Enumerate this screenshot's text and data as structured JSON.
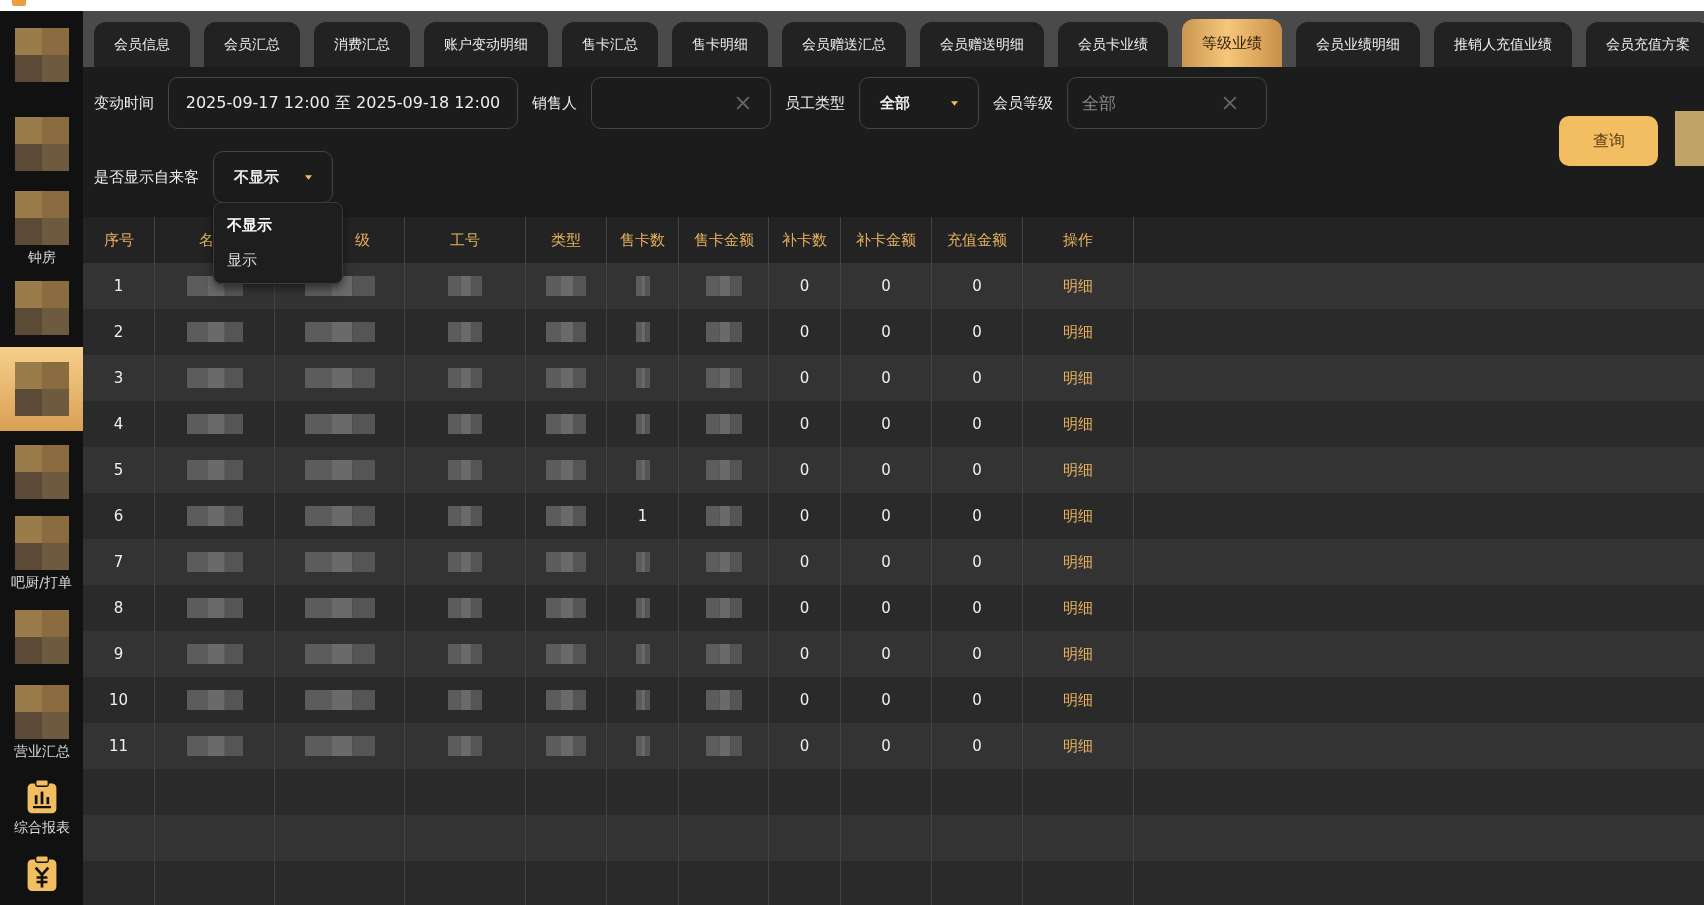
{
  "sidebar": {
    "items": [
      {
        "kind": "blurred",
        "selected": false
      },
      {
        "kind": "blurred",
        "selected": false
      },
      {
        "kind": "blurred",
        "label": "钟房",
        "selected": false
      },
      {
        "kind": "blurred",
        "selected": false
      },
      {
        "kind": "blurred",
        "selected": true
      },
      {
        "kind": "blurred",
        "selected": false
      },
      {
        "kind": "blurred",
        "label": "吧厨/打单",
        "selected": false
      },
      {
        "kind": "blurred",
        "selected": false
      },
      {
        "kind": "blurred",
        "label": "营业汇总",
        "selected": false
      },
      {
        "kind": "report",
        "label": "综合报表",
        "selected": false
      },
      {
        "kind": "yuan",
        "selected": false
      }
    ]
  },
  "tabs": [
    {
      "label": "会员信息",
      "selected": false
    },
    {
      "label": "会员汇总",
      "selected": false
    },
    {
      "label": "消费汇总",
      "selected": false
    },
    {
      "label": "账户变动明细",
      "selected": false
    },
    {
      "label": "售卡汇总",
      "selected": false
    },
    {
      "label": "售卡明细",
      "selected": false
    },
    {
      "label": "会员赠送汇总",
      "selected": false
    },
    {
      "label": "会员赠送明细",
      "selected": false
    },
    {
      "label": "会员卡业绩",
      "selected": false
    },
    {
      "label": "等级业绩",
      "selected": true
    },
    {
      "label": "会员业绩明细",
      "selected": false
    },
    {
      "label": "推销人充值业绩",
      "selected": false
    },
    {
      "label": "会员充值方案",
      "selected": false
    }
  ],
  "filters": {
    "change_time": {
      "label": "变动时间",
      "value": "2025-09-17 12:00 至 2025-09-18 12:00"
    },
    "salesperson": {
      "label": "销售人"
    },
    "staff_type": {
      "label": "员工类型",
      "value": "全部"
    },
    "member_level": {
      "label": "会员等级",
      "placeholder": "全部"
    },
    "show_walk_in": {
      "label": "是否显示自来客",
      "value": "不显示",
      "expanded": true,
      "options": [
        {
          "label": "不显示",
          "selected": true
        },
        {
          "label": "显示",
          "selected": false
        }
      ]
    },
    "query_button": "查询"
  },
  "table": {
    "columns": [
      "序号",
      "名",
      "级",
      "工号",
      "类型",
      "售卡数",
      "售卡金额",
      "补卡数",
      "补卡金额",
      "充值金额",
      "操作"
    ],
    "rows": [
      {
        "cells": [
          {
            "kind": "text",
            "text": "1"
          },
          {
            "kind": "blurred"
          },
          {
            "kind": "blurred"
          },
          {
            "kind": "blurred"
          },
          {
            "kind": "blurred"
          },
          {
            "kind": "blurred"
          },
          {
            "kind": "blurred"
          },
          {
            "kind": "text",
            "text": "0"
          },
          {
            "kind": "text",
            "text": "0"
          },
          {
            "kind": "text",
            "text": "0"
          },
          {
            "kind": "link",
            "text": "明细"
          }
        ]
      },
      {
        "cells": [
          {
            "kind": "text",
            "text": "2"
          },
          {
            "kind": "blurred"
          },
          {
            "kind": "blurred"
          },
          {
            "kind": "blurred"
          },
          {
            "kind": "blurred"
          },
          {
            "kind": "blurred"
          },
          {
            "kind": "blurred"
          },
          {
            "kind": "text",
            "text": "0"
          },
          {
            "kind": "text",
            "text": "0"
          },
          {
            "kind": "text",
            "text": "0"
          },
          {
            "kind": "link",
            "text": "明细"
          }
        ]
      },
      {
        "cells": [
          {
            "kind": "text",
            "text": "3"
          },
          {
            "kind": "blurred"
          },
          {
            "kind": "blurred"
          },
          {
            "kind": "blurred"
          },
          {
            "kind": "blurred"
          },
          {
            "kind": "blurred"
          },
          {
            "kind": "blurred"
          },
          {
            "kind": "text",
            "text": "0"
          },
          {
            "kind": "text",
            "text": "0"
          },
          {
            "kind": "text",
            "text": "0"
          },
          {
            "kind": "link",
            "text": "明细"
          }
        ]
      },
      {
        "cells": [
          {
            "kind": "text",
            "text": "4"
          },
          {
            "kind": "blurred"
          },
          {
            "kind": "blurred"
          },
          {
            "kind": "blurred"
          },
          {
            "kind": "blurred"
          },
          {
            "kind": "blurred"
          },
          {
            "kind": "blurred"
          },
          {
            "kind": "text",
            "text": "0"
          },
          {
            "kind": "text",
            "text": "0"
          },
          {
            "kind": "text",
            "text": "0"
          },
          {
            "kind": "link",
            "text": "明细"
          }
        ]
      },
      {
        "cells": [
          {
            "kind": "text",
            "text": "5"
          },
          {
            "kind": "blurred"
          },
          {
            "kind": "blurred"
          },
          {
            "kind": "blurred"
          },
          {
            "kind": "blurred"
          },
          {
            "kind": "blurred"
          },
          {
            "kind": "blurred"
          },
          {
            "kind": "text",
            "text": "0"
          },
          {
            "kind": "text",
            "text": "0"
          },
          {
            "kind": "text",
            "text": "0"
          },
          {
            "kind": "link",
            "text": "明细"
          }
        ]
      },
      {
        "cells": [
          {
            "kind": "text",
            "text": "6"
          },
          {
            "kind": "blurred"
          },
          {
            "kind": "blurred"
          },
          {
            "kind": "blurred"
          },
          {
            "kind": "blurred"
          },
          {
            "kind": "text",
            "text": "1"
          },
          {
            "kind": "blurred"
          },
          {
            "kind": "text",
            "text": "0"
          },
          {
            "kind": "text",
            "text": "0"
          },
          {
            "kind": "text",
            "text": "0"
          },
          {
            "kind": "link",
            "text": "明细"
          }
        ]
      },
      {
        "cells": [
          {
            "kind": "text",
            "text": "7"
          },
          {
            "kind": "blurred"
          },
          {
            "kind": "blurred"
          },
          {
            "kind": "blurred"
          },
          {
            "kind": "blurred"
          },
          {
            "kind": "blurred"
          },
          {
            "kind": "blurred"
          },
          {
            "kind": "text",
            "text": "0"
          },
          {
            "kind": "text",
            "text": "0"
          },
          {
            "kind": "text",
            "text": "0"
          },
          {
            "kind": "link",
            "text": "明细"
          }
        ]
      },
      {
        "cells": [
          {
            "kind": "text",
            "text": "8"
          },
          {
            "kind": "blurred"
          },
          {
            "kind": "blurred"
          },
          {
            "kind": "blurred"
          },
          {
            "kind": "blurred"
          },
          {
            "kind": "blurred"
          },
          {
            "kind": "blurred"
          },
          {
            "kind": "text",
            "text": "0"
          },
          {
            "kind": "text",
            "text": "0"
          },
          {
            "kind": "text",
            "text": "0"
          },
          {
            "kind": "link",
            "text": "明细"
          }
        ]
      },
      {
        "cells": [
          {
            "kind": "text",
            "text": "9"
          },
          {
            "kind": "blurred"
          },
          {
            "kind": "blurred"
          },
          {
            "kind": "blurred"
          },
          {
            "kind": "blurred"
          },
          {
            "kind": "blurred"
          },
          {
            "kind": "blurred"
          },
          {
            "kind": "text",
            "text": "0"
          },
          {
            "kind": "text",
            "text": "0"
          },
          {
            "kind": "text",
            "text": "0"
          },
          {
            "kind": "link",
            "text": "明细"
          }
        ]
      },
      {
        "cells": [
          {
            "kind": "text",
            "text": "10"
          },
          {
            "kind": "blurred"
          },
          {
            "kind": "blurred"
          },
          {
            "kind": "blurred"
          },
          {
            "kind": "blurred"
          },
          {
            "kind": "blurred"
          },
          {
            "kind": "blurred"
          },
          {
            "kind": "text",
            "text": "0"
          },
          {
            "kind": "text",
            "text": "0"
          },
          {
            "kind": "text",
            "text": "0"
          },
          {
            "kind": "link",
            "text": "明细"
          }
        ]
      },
      {
        "cells": [
          {
            "kind": "text",
            "text": "11"
          },
          {
            "kind": "blurred"
          },
          {
            "kind": "blurred"
          },
          {
            "kind": "blurred"
          },
          {
            "kind": "blurred"
          },
          {
            "kind": "blurred"
          },
          {
            "kind": "blurred"
          },
          {
            "kind": "text",
            "text": "0"
          },
          {
            "kind": "text",
            "text": "0"
          },
          {
            "kind": "text",
            "text": "0"
          },
          {
            "kind": "link",
            "text": "明细"
          }
        ]
      }
    ]
  }
}
